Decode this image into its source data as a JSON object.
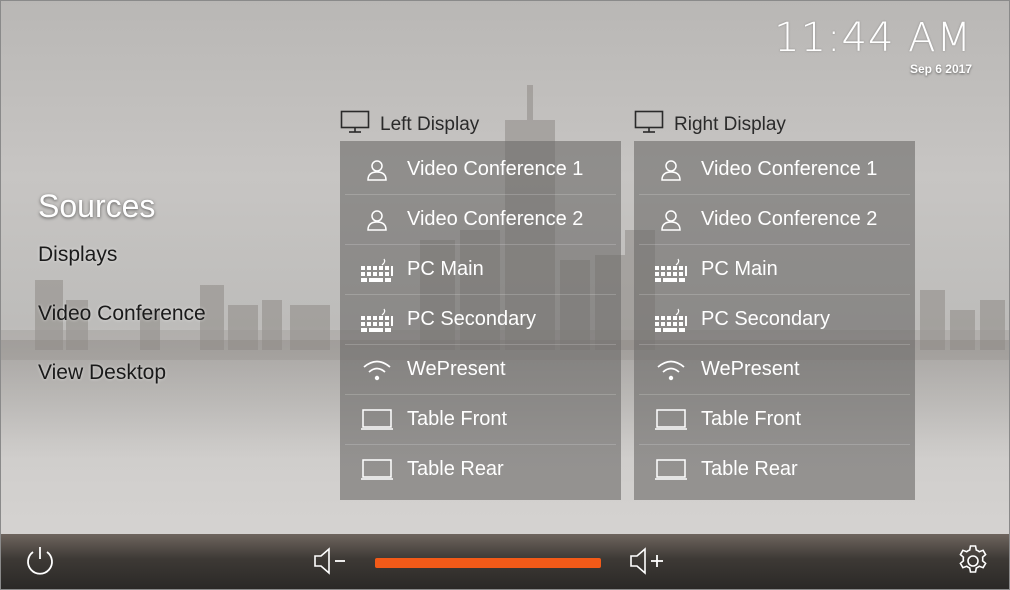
{
  "clock": {
    "time": "11:44 AM",
    "date": "Sep 6 2017"
  },
  "nav": {
    "title": "Sources",
    "items": [
      "Displays",
      "Video Conference",
      "View Desktop"
    ]
  },
  "left_display": {
    "title": "Left Display",
    "sources": [
      {
        "label": "Video Conference 1",
        "icon": "person-icon"
      },
      {
        "label": "Video Conference 2",
        "icon": "person-icon"
      },
      {
        "label": "PC Main",
        "icon": "keyboard-icon"
      },
      {
        "label": "PC Secondary",
        "icon": "keyboard-icon"
      },
      {
        "label": "WePresent",
        "icon": "wifi-icon"
      },
      {
        "label": "Table Front",
        "icon": "laptop-icon"
      },
      {
        "label": "Table Rear",
        "icon": "laptop-icon"
      }
    ]
  },
  "right_display": {
    "title": "Right Display",
    "sources": [
      {
        "label": "Video Conference 1",
        "icon": "person-icon"
      },
      {
        "label": "Video Conference 2",
        "icon": "person-icon"
      },
      {
        "label": "PC Main",
        "icon": "keyboard-icon"
      },
      {
        "label": "PC Secondary",
        "icon": "keyboard-icon"
      },
      {
        "label": "WePresent",
        "icon": "wifi-icon"
      },
      {
        "label": "Table Front",
        "icon": "laptop-icon"
      },
      {
        "label": "Table Rear",
        "icon": "laptop-icon"
      }
    ]
  },
  "controls": {
    "volume_level": 1.0,
    "volume_color": "#f25a18",
    "icons": [
      "power-icon",
      "volume-down-icon",
      "volume-up-icon",
      "gear-icon"
    ]
  }
}
